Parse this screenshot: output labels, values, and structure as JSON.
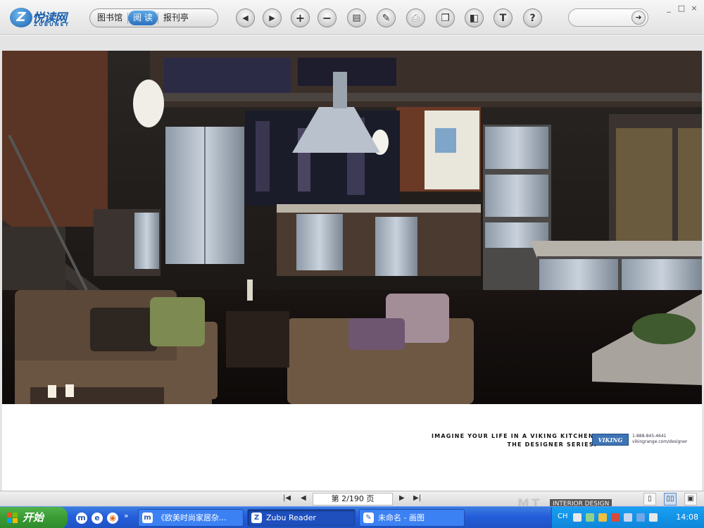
{
  "app": {
    "logo_mark": "Z",
    "logo_text": "悦读网",
    "logo_sub": "ZUBUNET"
  },
  "toolbar": {
    "tabs": [
      {
        "label": "图书馆",
        "active": false
      },
      {
        "label": "阅 读",
        "active": true
      },
      {
        "label": "报刊亭",
        "active": false
      }
    ],
    "buttons": [
      {
        "name": "prev-page-icon",
        "glyph": "◀"
      },
      {
        "name": "next-page-icon",
        "glyph": "▶"
      },
      {
        "name": "zoom-in-icon",
        "glyph": "+"
      },
      {
        "name": "zoom-out-icon",
        "glyph": "−"
      },
      {
        "name": "book-icon",
        "glyph": "▤"
      },
      {
        "name": "pen-icon",
        "glyph": "✎"
      },
      {
        "name": "print-icon",
        "glyph": "⎙"
      },
      {
        "name": "copy-icon",
        "glyph": "❐"
      },
      {
        "name": "bookmark-icon",
        "glyph": "◧"
      },
      {
        "name": "text-icon",
        "glyph": "T"
      },
      {
        "name": "help-icon",
        "glyph": "?"
      }
    ],
    "search": {
      "value": "",
      "go_glyph": "➜"
    },
    "window_controls": [
      "_",
      "□",
      "×"
    ]
  },
  "page": {
    "tagline_line1": "IMAGINE YOUR LIFE IN A VIKING KITCHEN.",
    "tagline_line2": "THE DESIGNER SERIES.",
    "brand": "VIKING",
    "brand_phone": "1-888-845-4641",
    "brand_url": "vikingrange.com/designer"
  },
  "pager": {
    "first": "|◀",
    "prev": "◀",
    "current": "第 2/190 页",
    "next": "▶",
    "last": "▶|",
    "watermark": "MT",
    "watermark_badge": "INTERIOR DESIGN"
  },
  "taskbar": {
    "start_label": "开始",
    "quicklaunch": [
      "m",
      "e",
      "◉"
    ],
    "overflow": "»",
    "tasks": [
      {
        "icon": "m",
        "label": "《欧美时尚家居杂...",
        "active": false
      },
      {
        "icon": "Z",
        "label": "Zubu Reader",
        "active": true
      },
      {
        "icon": "✎",
        "label": "未命名 - 画图",
        "active": false
      }
    ],
    "tray_lang": "CH",
    "clock": "14:08"
  },
  "colors": {
    "accent": "#2b72bf",
    "taskbar": "#245edb",
    "start": "#3a9a35",
    "brand": "#3f74b4"
  }
}
